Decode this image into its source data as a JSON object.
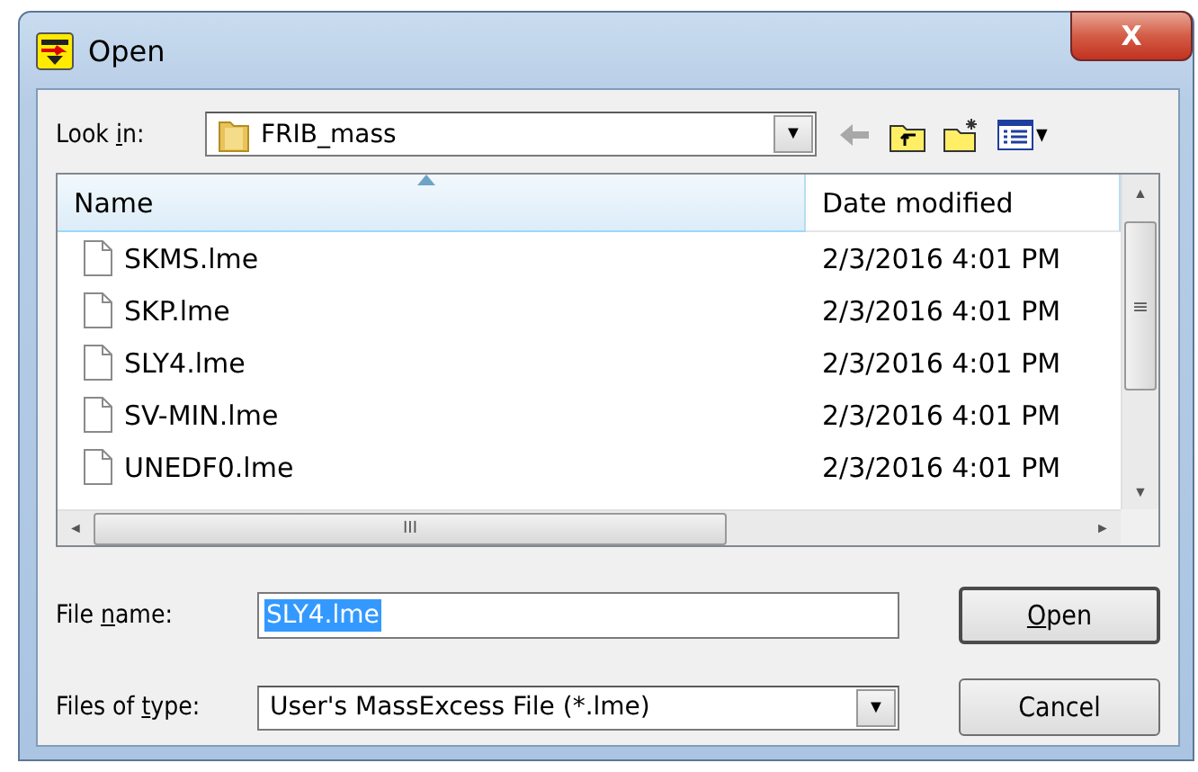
{
  "window": {
    "title": "Open",
    "close_label": "X"
  },
  "look_in": {
    "label": {
      "before": "Look ",
      "key": "i",
      "after": "n:"
    },
    "value": "FRIB_mass",
    "dropdown_glyph": "▼"
  },
  "toolbar": {
    "view_menu_glyph": "▾"
  },
  "file_list": {
    "columns": [
      {
        "label": "Name",
        "sorted": true
      },
      {
        "label": "Date modified",
        "sorted": false
      }
    ],
    "rows": [
      {
        "name": "SKMS.lme",
        "date": "2/3/2016 4:01 PM",
        "selected": false
      },
      {
        "name": "SKP.lme",
        "date": "2/3/2016 4:01 PM",
        "selected": false
      },
      {
        "name": "SLY4.lme",
        "date": "2/3/2016 4:01 PM",
        "selected": false
      },
      {
        "name": "SV-MIN.lme",
        "date": "2/3/2016 4:01 PM",
        "selected": false
      },
      {
        "name": "UNEDF0.lme",
        "date": "2/3/2016 4:01 PM",
        "selected": false
      }
    ],
    "scroll_glyphs": {
      "up": "▲",
      "down": "▼",
      "left": "◄",
      "right": "►",
      "grip_v": "≡",
      "grip_h": "III"
    }
  },
  "file_name": {
    "label": {
      "before": "File ",
      "key": "n",
      "after": "ame:"
    },
    "value": "SLY4.lme",
    "value_selected": true
  },
  "file_type": {
    "label": {
      "before": "Files of ",
      "key": "t",
      "after": "ype:"
    },
    "value": "User's MassExcess File (*.lme)",
    "dropdown_glyph": "▼"
  },
  "buttons": [
    {
      "label": {
        "key": "O",
        "after": "pen"
      },
      "default": true
    },
    {
      "label": {
        "before": "Cancel"
      },
      "default": false
    }
  ]
}
